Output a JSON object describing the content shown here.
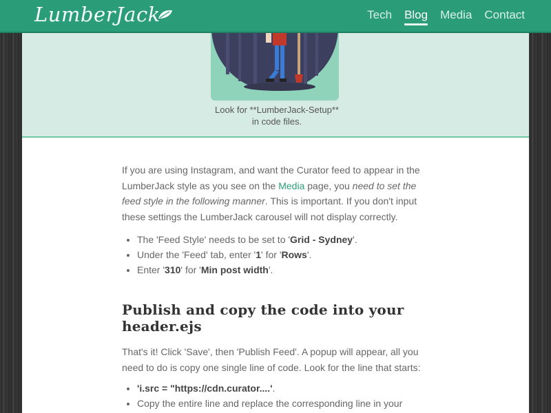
{
  "brand": {
    "name": "LumberJack",
    "icon": "leaf-icon"
  },
  "nav": {
    "items": [
      {
        "label": "Tech",
        "active": false
      },
      {
        "label": "Blog",
        "active": true
      },
      {
        "label": "Media",
        "active": false
      },
      {
        "label": "Contact",
        "active": false
      }
    ]
  },
  "hero": {
    "caption_line1": "Look for **LumberJack-Setup**",
    "caption_line2": "in code files."
  },
  "article": {
    "p1": {
      "t1": "If you are using Instagram, and want the Curator feed to appear in the LumberJack style as you see on the ",
      "link": "Media",
      "t2": " page, you ",
      "em": "need to set the feed style in the following manner",
      "t3": ". This is important. If you don't input these settings the LumberJack carousel will not display correctly."
    },
    "list1": [
      {
        "pre": "The 'Feed Style' needs to be set to '",
        "b": "Grid - Sydney",
        "post": "'."
      },
      {
        "pre": "Under the 'Feed' tab, enter '",
        "b": "1",
        "mid": "' for '",
        "b2": "Rows",
        "post": "'."
      },
      {
        "pre": "Enter '",
        "b": "310",
        "mid": "' for '",
        "b2": "Min post width",
        "post": "'."
      }
    ],
    "heading": "Publish and copy the code into your header.ejs",
    "p2": "That's it! Click 'Save', then 'Publish Feed'. A popup will appear, all you need to do is copy one single line of code. Look for the line that starts:",
    "list2": [
      {
        "b": "'i.src = \"https://cdn.curator....'",
        "post": "."
      },
      {
        "text": "Copy the entire line and replace the corresponding line in your /views/partials/footer.ejs file."
      }
    ]
  }
}
